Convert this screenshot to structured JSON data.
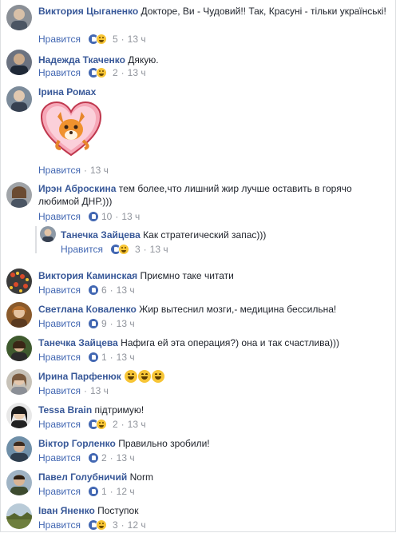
{
  "ui": {
    "like_label": "Нравится",
    "dot": "·"
  },
  "comments": [
    {
      "name": "Виктория Цыганенко",
      "text": "Докторе, Ви - Чудовий!! Так, Красуні - тільки українські!",
      "reactions": 5,
      "time": "13 ч",
      "react_types": [
        "thumb-icon",
        "haha-icon"
      ]
    },
    {
      "name": "Надежда Ткаченко",
      "text": "Дякую.",
      "reactions": 2,
      "time": "13 ч",
      "react_types": [
        "thumb-icon",
        "haha-icon"
      ]
    },
    {
      "name": "Ірина Ромах",
      "text": "",
      "sticker": "fox-heart-sticker",
      "time": "13 ч"
    },
    {
      "name": "Ирэн Аброскина",
      "text": "тем более,что лишний жир лучше оставить в горячо любимой ДНР.)))",
      "reactions": 10,
      "time": "13 ч",
      "react_types": [
        "thumb-icon"
      ]
    },
    {
      "name": "Танечка Зайцева",
      "text": "Как стратегический запас)))",
      "reactions": 3,
      "time": "13 ч",
      "react_types": [
        "thumb-icon",
        "haha-icon"
      ],
      "reply": true
    },
    {
      "name": "Виктория Каминская",
      "text": "Приємно таке читати",
      "reactions": 6,
      "time": "13 ч",
      "react_types": [
        "thumb-icon"
      ]
    },
    {
      "name": "Светлана Коваленко",
      "text": "Жир вытеснил мозги,- медицина бессильна!",
      "reactions": 9,
      "time": "13 ч",
      "react_types": [
        "thumb-icon"
      ]
    },
    {
      "name": "Танечка Зайцева",
      "text": "Нафига ей эта операция?) она и так счастлива)))",
      "reactions": 1,
      "time": "13 ч",
      "react_types": [
        "thumb-icon"
      ]
    },
    {
      "name": "Ирина Парфенюк",
      "text": "",
      "emoji_count": 3,
      "time": "13 ч"
    },
    {
      "name": "Tessa Brain",
      "text": "підтримую!",
      "reactions": 2,
      "time": "13 ч",
      "react_types": [
        "thumb-icon",
        "haha-icon"
      ]
    },
    {
      "name": "Віктор Горленко",
      "text": "Правильно зробили!",
      "reactions": 2,
      "time": "13 ч",
      "react_types": [
        "thumb-icon"
      ]
    },
    {
      "name": "Павел Голубничий",
      "text": "Norm",
      "reactions": 1,
      "time": "12 ч",
      "react_types": [
        "thumb-icon"
      ]
    },
    {
      "name": "Іван Яненко",
      "text": "Поступок",
      "reactions": 3,
      "time": "12 ч",
      "react_types": [
        "thumb-icon",
        "haha-icon"
      ]
    }
  ],
  "colors": {
    "name": "#385898",
    "link": "#4267b2",
    "meta": "#90949c",
    "haha": "#f7c536"
  }
}
